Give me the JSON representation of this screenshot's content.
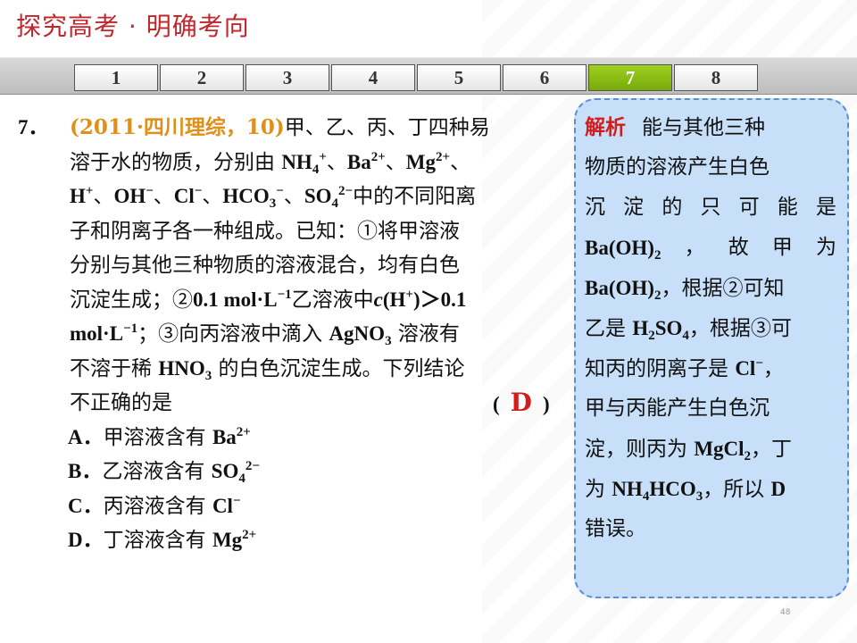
{
  "header": {
    "title": "探究高考 · 明确考向"
  },
  "nav": {
    "tabs": [
      "1",
      "2",
      "3",
      "4",
      "5",
      "6",
      "7",
      "8"
    ],
    "active": "7"
  },
  "question": {
    "number": "7．",
    "source": "(2011·四川理综，10)",
    "l1_text": "甲、乙、丙、丁四种易",
    "l2_a": "溶于水的物质，分别由 ",
    "l2_nh": "NH",
    "l2_nh_sub": "4",
    "l2_nh_sup": "+",
    "l2_b": "、",
    "l2_ba": "Ba",
    "l2_ba_sup": "2+",
    "l2_c": "、",
    "l2_mg": "Mg",
    "l2_mg_sup": "2+",
    "l2_d": "、",
    "l3_h": "H",
    "l3_h_sup": "+",
    "l3_a": "、",
    "l3_oh": "OH",
    "l3_oh_sup": "−",
    "l3_b": "、",
    "l3_cl": "Cl",
    "l3_cl_sup": "−",
    "l3_c": "、",
    "l3_hco": "HCO",
    "l3_hco_sub": "3",
    "l3_hco_sup": "−",
    "l3_d": "、",
    "l3_so": "SO",
    "l3_so_sub": "4",
    "l3_so_sup": "2−",
    "l3_e": "中的不同阳离",
    "l4": "子和阴离子各一种组成。已知：①将甲溶液",
    "l5": "分别与其他三种物质的溶液混合，均有白色",
    "l6_a": "沉淀生成；②",
    "l6_conc": "0.1 mol·L",
    "l6_unit_sup": "−1",
    "l6_b": "乙溶液中",
    "l6_c": "c",
    "l6_hp": "(H",
    "l6_hp_sup": "+",
    "l6_d": ")＞0.1",
    "l7_mol": "mol·L",
    "l7_mol_sup": "−1",
    "l7_a": "；③向丙溶液中滴入 ",
    "l7_ag": "AgNO",
    "l7_ag_sub": "3",
    "l7_b": " 溶液有",
    "l8_a": "不溶于稀 ",
    "l8_hno": "HNO",
    "l8_hno_sub": "3",
    "l8_b": " 的白色沉淀生成。下列结论",
    "l9": "不正确的是",
    "paren_open": "(",
    "answer": "D",
    "paren_close": ")"
  },
  "options": [
    {
      "label": "A．",
      "text": "甲溶液含有 ",
      "ion": "Ba",
      "sub": "",
      "sup": "2+"
    },
    {
      "label": "B．",
      "text": "乙溶液含有 ",
      "ion": "SO",
      "sub": "4",
      "sup": "2−"
    },
    {
      "label": "C．",
      "text": "丙溶液含有 ",
      "ion": "Cl",
      "sub": "",
      "sup": "−"
    },
    {
      "label": "D．",
      "text": "丁溶液含有 ",
      "ion": "Mg",
      "sub": "",
      "sup": "2+"
    }
  ],
  "analysis": {
    "title": "解析",
    "l1": "能与其他三种",
    "l2": "物质的溶液产生白色",
    "l3": [
      "沉",
      "淀",
      "的",
      "只",
      "可",
      "能",
      "是"
    ],
    "l4_ba": "Ba(OH)",
    "l4_sub": "2",
    "l4_w": [
      "，",
      "故",
      "甲",
      "为"
    ],
    "l5_ba": "Ba(OH)",
    "l5_sub": "2",
    "l5_rest": "，根据②可知",
    "l6_a": "乙是 ",
    "l6_h": "H",
    "l6_h_sub": "2",
    "l6_so": "SO",
    "l6_so_sub": "4",
    "l6_rest": "，根据③可",
    "l7_a": "知丙的阴离子是 ",
    "l7_cl": "Cl",
    "l7_sup": "−",
    "l7_b": "，",
    "l8": "甲与丙能产生白色沉",
    "l9_a": "淀，则丙为 ",
    "l9_mg": "MgCl",
    "l9_sub": "2",
    "l9_b": "，丁",
    "l10_a": "为 ",
    "l10_nh": "NH",
    "l10_nh_sub": "4",
    "l10_hco": "HCO",
    "l10_hco_sub": "3",
    "l10_b": "，所以 ",
    "l10_d": "D",
    "l11": "错误。"
  },
  "page_number": "48"
}
